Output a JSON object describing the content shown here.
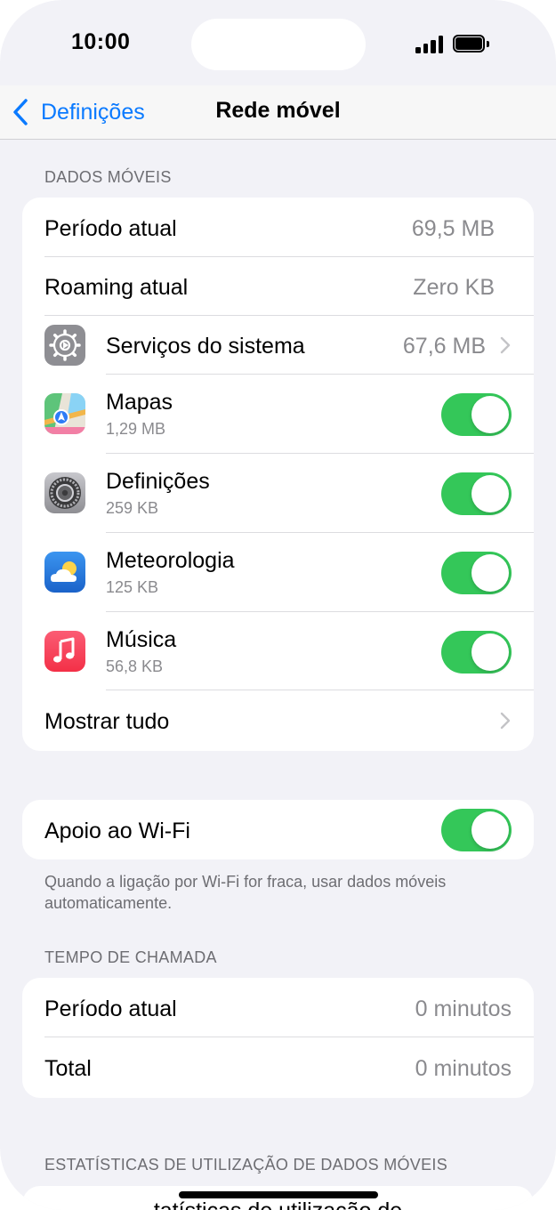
{
  "status": {
    "time": "10:00"
  },
  "nav": {
    "back_label": "Definições",
    "title": "Rede móvel"
  },
  "mobile_data": {
    "header": "DADOS MÓVEIS",
    "current_period": {
      "label": "Período atual",
      "value": "69,5 MB"
    },
    "current_roaming": {
      "label": "Roaming atual",
      "value": "Zero KB"
    },
    "system_services": {
      "label": "Serviços do sistema",
      "value": "67,6 MB",
      "icon": "gear-icon"
    },
    "apps": [
      {
        "name": "Mapas",
        "usage": "1,29 MB",
        "icon": "maps-icon",
        "enabled": true
      },
      {
        "name": "Definições",
        "usage": "259 KB",
        "icon": "settings-icon",
        "enabled": true
      },
      {
        "name": "Meteorologia",
        "usage": "125 KB",
        "icon": "weather-icon",
        "enabled": true
      },
      {
        "name": "Música",
        "usage": "56,8 KB",
        "icon": "music-icon",
        "enabled": true
      }
    ],
    "show_all": "Mostrar tudo"
  },
  "wifi_assist": {
    "label": "Apoio ao Wi-Fi",
    "enabled": true,
    "footnote": "Quando a ligação por Wi-Fi for fraca, usar dados móveis automaticamente."
  },
  "call_time": {
    "header": "TEMPO DE CHAMADA",
    "current_period": {
      "label": "Período atual",
      "value": "0 minutos"
    },
    "total": {
      "label": "Total",
      "value": "0 minutos"
    }
  },
  "stats": {
    "header": "ESTATÍSTICAS DE UTILIZAÇÃO DE DADOS MÓVEIS",
    "partial_row": "...tatísticas de utilização de..."
  },
  "colors": {
    "accent": "#0a7aff",
    "toggle_on": "#34c759",
    "background": "#f2f2f7"
  }
}
